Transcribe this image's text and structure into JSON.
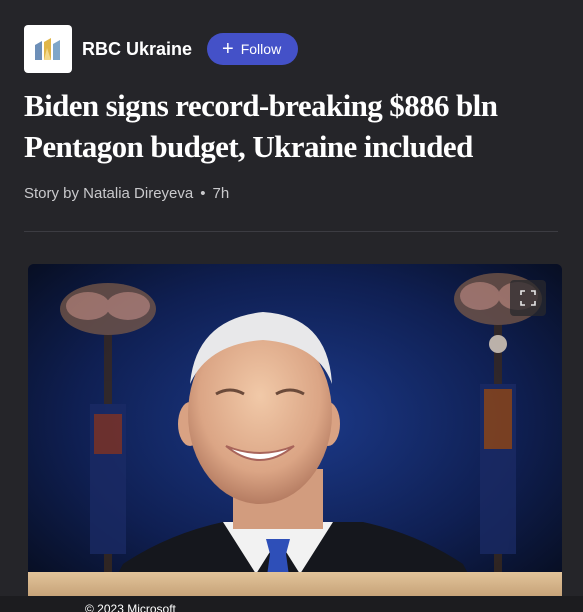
{
  "publisher": {
    "name": "RBC Ukraine",
    "logo_icon": "rbc-ukraine-logo-icon",
    "follow_label": "Follow",
    "follow_icon": "plus-icon",
    "follow_color": "#4451c8"
  },
  "article": {
    "headline": "Biden signs record-breaking $886 bln Pentagon budget, Ukraine included",
    "byline": "Story by Natalia Direyeva",
    "separator": "•",
    "time_ago": "7h"
  },
  "hero_image": {
    "description_icon": "article-photo",
    "expand_icon": "expand-icon"
  },
  "footer": {
    "copyright": "© 2023 Microsoft"
  }
}
